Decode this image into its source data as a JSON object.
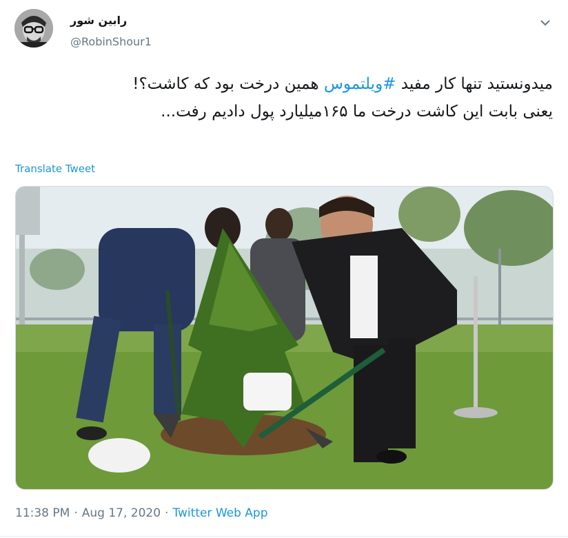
{
  "tweet": {
    "author_name": "رابین شور",
    "author_handle": "@RobinShour1",
    "text_before_hashtag": "میدونستید تنها کار مفید ",
    "hashtag": "#ویلتموس",
    "text_after_hashtag": " همین درخت بود که کاشت؟!\nیعنی بابت این کاشت درخت ما ۱۶۵میلیارد پول دادیم رفت...",
    "translate_label": "Translate Tweet",
    "time": "11:38 PM",
    "separator": "·",
    "date": "Aug 17, 2020",
    "source": "Twitter Web App"
  },
  "icons": {
    "menu": "chevron-down-icon"
  },
  "colors": {
    "link": "#1b95e0",
    "secondary_text": "#657786",
    "primary_text": "#14171a"
  }
}
